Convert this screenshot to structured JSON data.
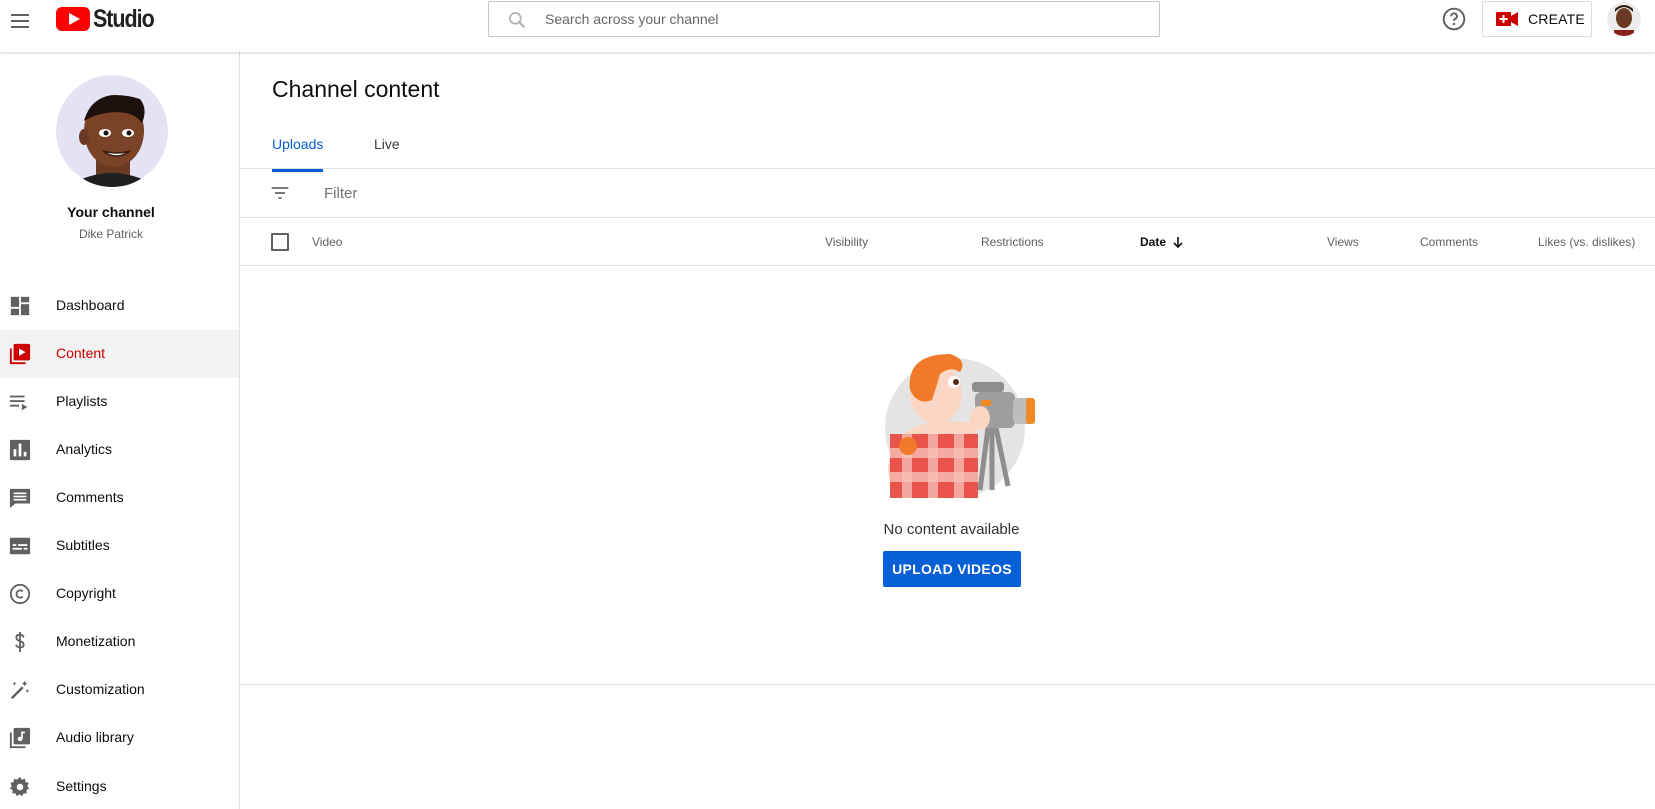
{
  "header": {
    "logo_text": "Studio",
    "search_placeholder": "Search across your channel",
    "create_label": "CREATE"
  },
  "channel": {
    "title": "Your channel",
    "name": "Dike Patrick"
  },
  "sidebar": {
    "items": [
      {
        "label": "Dashboard",
        "icon": "dashboard-icon"
      },
      {
        "label": "Content",
        "icon": "content-icon",
        "active": true
      },
      {
        "label": "Playlists",
        "icon": "playlists-icon"
      },
      {
        "label": "Analytics",
        "icon": "analytics-icon"
      },
      {
        "label": "Comments",
        "icon": "comments-icon"
      },
      {
        "label": "Subtitles",
        "icon": "subtitles-icon"
      },
      {
        "label": "Copyright",
        "icon": "copyright-icon"
      },
      {
        "label": "Monetization",
        "icon": "dollar-icon"
      },
      {
        "label": "Customization",
        "icon": "magic-wand-icon"
      },
      {
        "label": "Audio library",
        "icon": "audio-library-icon"
      }
    ],
    "settings_label": "Settings"
  },
  "main": {
    "title": "Channel content",
    "tabs": [
      {
        "label": "Uploads",
        "active": true
      },
      {
        "label": "Live"
      }
    ],
    "filter_placeholder": "Filter",
    "columns": [
      "Video",
      "Visibility",
      "Restrictions",
      "Date",
      "Views",
      "Comments",
      "Likes (vs. dislikes)"
    ],
    "sorted_column": "Date",
    "empty_message": "No content available",
    "upload_button": "UPLOAD VIDEOS"
  },
  "colors": {
    "accent_blue": "#065fd4",
    "active_red": "#cc0000",
    "brand_red": "#ff0000"
  }
}
